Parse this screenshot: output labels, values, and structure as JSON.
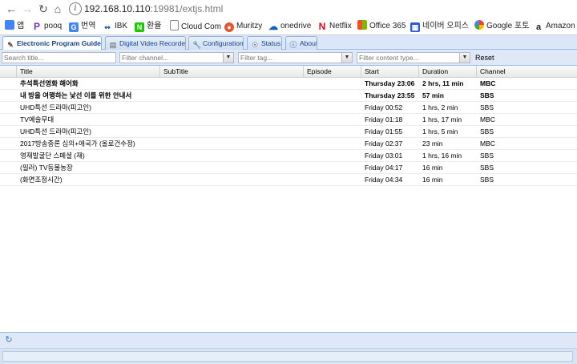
{
  "browser": {
    "url_host": "192.168.10.110",
    "url_rest": ":19981/extjs.html",
    "bookmarks": [
      {
        "label": "앱",
        "icon": "apps-grid-icon",
        "color": "#4285f4"
      },
      {
        "label": "pooq",
        "icon": "pooq-p-icon",
        "color": "#7b2fbe"
      },
      {
        "label": "번역",
        "icon": "translate-icon",
        "color": "#4285f4"
      },
      {
        "label": "IBK",
        "icon": "ibk-bank-icon",
        "color": "#1a56a6"
      },
      {
        "label": "환율",
        "icon": "naver-n-icon",
        "color": "#1ec800"
      },
      {
        "label": "Cloud Com",
        "icon": "page-icon",
        "color": "#888888"
      },
      {
        "label": "Muritzy",
        "icon": "muritzy-icon",
        "color": "#e4572e"
      },
      {
        "label": "onedrive",
        "icon": "cloud-icon",
        "color": "#0b63c4"
      },
      {
        "label": "Netflix",
        "icon": "netflix-n-icon",
        "color": "#e50914"
      },
      {
        "label": "Office 365",
        "icon": "office-windows-icon",
        "color": "#f25022"
      },
      {
        "label": "네이버 오피스",
        "icon": "naver-office-icon",
        "color": "#2d5ad6"
      },
      {
        "label": "Google 포토",
        "icon": "google-photos-icon",
        "color": "#fbbc05"
      },
      {
        "label": "Amazon C",
        "icon": "amazon-a-icon",
        "color": "#222222"
      }
    ]
  },
  "tabs": [
    {
      "label": "Electronic Program Guide",
      "icon": "epg-icon",
      "active": true
    },
    {
      "label": "Digital Video Recorder",
      "icon": "dvr-icon",
      "active": false
    },
    {
      "label": "Configuration",
      "icon": "wrench-icon",
      "active": false
    },
    {
      "label": "Status",
      "icon": "eye-icon",
      "active": false
    },
    {
      "label": "About",
      "icon": "info-icon",
      "active": false
    }
  ],
  "filters": {
    "title_placeholder": "Search title...",
    "channel_placeholder": "Filter channel...",
    "tag_placeholder": "Filter tag...",
    "content_type_placeholder": "Filter content type...",
    "reset_label": "Reset"
  },
  "grid": {
    "columns": [
      "Title",
      "SubTitle",
      "Episode",
      "Start",
      "Duration",
      "Channel"
    ],
    "rows": [
      {
        "title": "추석특선영화 해어화",
        "subtitle": "",
        "episode": "",
        "start": "Thursday 23:06",
        "duration": "2 hrs, 11 min",
        "channel": "MBC",
        "bold": true
      },
      {
        "title": "내 방을 여행하는 낯선 이를 위한 안내서",
        "subtitle": "",
        "episode": "",
        "start": "Thursday 23:55",
        "duration": "57 min",
        "channel": "SBS",
        "bold": true
      },
      {
        "title": "UHD특선 드라마(피고인)",
        "subtitle": "",
        "episode": "",
        "start": "Friday 00:52",
        "duration": "1 hrs, 2 min",
        "channel": "SBS",
        "bold": false
      },
      {
        "title": "TV예술무대",
        "subtitle": "",
        "episode": "",
        "start": "Friday 01:18",
        "duration": "1 hrs, 17 min",
        "channel": "MBC",
        "bold": false
      },
      {
        "title": "UHD특선 드라마(피고인)",
        "subtitle": "",
        "episode": "",
        "start": "Friday 01:55",
        "duration": "1 hrs, 5 min",
        "channel": "SBS",
        "bold": false
      },
      {
        "title": "2017방송중론 심의+애국가 (올로건수정)",
        "subtitle": "",
        "episode": "",
        "start": "Friday 02:37",
        "duration": "23 min",
        "channel": "MBC",
        "bold": false
      },
      {
        "title": "영재발굴단 스페셜 (재)",
        "subtitle": "",
        "episode": "",
        "start": "Friday 03:01",
        "duration": "1 hrs, 16 min",
        "channel": "SBS",
        "bold": false
      },
      {
        "title": "(필러) TV동물농장",
        "subtitle": "",
        "episode": "",
        "start": "Friday 04:17",
        "duration": "16 min",
        "channel": "SBS",
        "bold": false
      },
      {
        "title": "(화면조정시간)",
        "subtitle": "",
        "episode": "",
        "start": "Friday 04:34",
        "duration": "16 min",
        "channel": "SBS",
        "bold": false
      }
    ]
  }
}
